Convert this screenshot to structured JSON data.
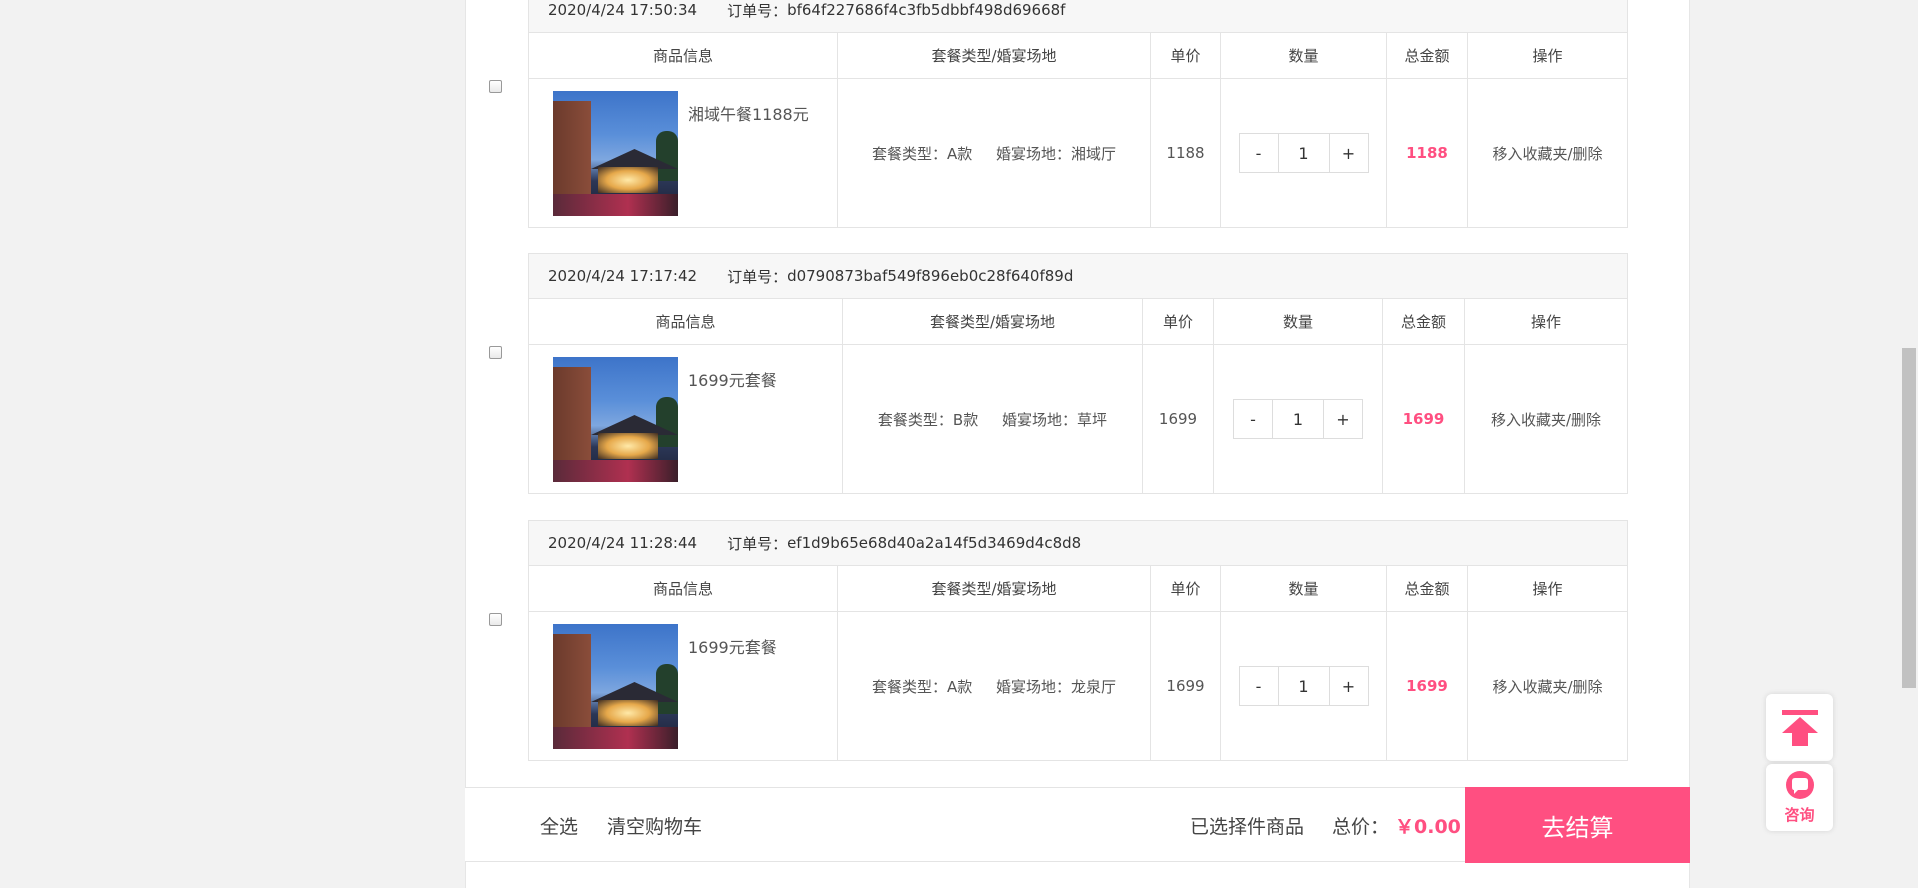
{
  "columns": {
    "product": "商品信息",
    "type_venue": "套餐类型/婚宴场地",
    "unit_price": "单价",
    "quantity": "数量",
    "total": "总金额",
    "action": "操作"
  },
  "orders": [
    {
      "date": "2020/4/24 17:50:34",
      "order_no_label": "订单号：",
      "order_no": "bf64f227686f4c3fb5dbbf498d69668f",
      "product_name": "湘域午餐1188元",
      "type_venue": "套餐类型：A款     婚宴场地：湘域厅",
      "unit_price": "1188",
      "qty_minus": "-",
      "qty": "1",
      "qty_plus": "+",
      "total": "1188",
      "action": "移入收藏夹/删除"
    },
    {
      "date": "2020/4/24 17:17:42",
      "order_no_label": "订单号：",
      "order_no": "d0790873baf549f896eb0c28f640f89d",
      "product_name": "1699元套餐",
      "type_venue": "套餐类型：B款     婚宴场地：草坪",
      "unit_price": "1699",
      "qty_minus": "-",
      "qty": "1",
      "qty_plus": "+",
      "total": "1699",
      "action": "移入收藏夹/删除"
    },
    {
      "date": "2020/4/24 11:28:44",
      "order_no_label": "订单号：",
      "order_no": "ef1d9b65e68d40a2a14f5d3469d4c8d8",
      "product_name": "1699元套餐",
      "type_venue": "套餐类型：A款     婚宴场地：龙泉厅",
      "unit_price": "1699",
      "qty_minus": "-",
      "qty": "1",
      "qty_plus": "+",
      "total": "1699",
      "action": "移入收藏夹/删除"
    }
  ],
  "footer": {
    "select_all": "全选",
    "clear_cart": "清空购物车",
    "selected_items": "已选择件商品",
    "total_label": "总价：",
    "total_value": "￥0.00",
    "checkout": "去结算"
  },
  "side": {
    "consult_label": "咨询",
    "top_icon": "arrow-up-to-top-icon",
    "consult_icon": "chat-bubble-icon"
  },
  "colors": {
    "accent": "#ff4f81",
    "border": "#e4e4e4",
    "header_bg": "#f7f7f7"
  }
}
